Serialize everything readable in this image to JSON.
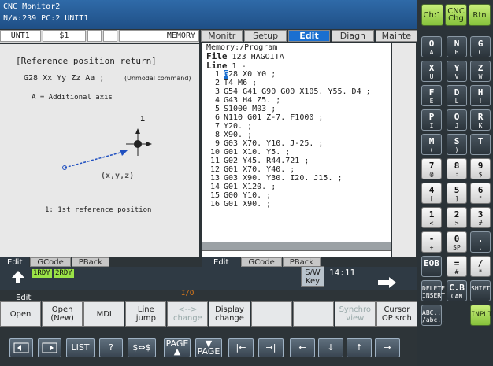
{
  "header": {
    "title_line1": "CNC Monitor2",
    "title_line2": "N/W:239 PC:2 UNIT1",
    "buttons": [
      "Ch:1",
      "CNC Chg",
      "Rtn"
    ]
  },
  "status_row": {
    "unit": "UNT1",
    "cell2": "$1",
    "mode": "MEMORY"
  },
  "guide": {
    "title": "[Reference position return]",
    "command": "G28 Xx Yy Zz Aa ;",
    "unmodal": "(Unmodal command)",
    "axis_note": "A = Additional axis",
    "point_label_1": "1",
    "point_label_xyz": "(x,y,z)",
    "ref_note": "1: 1st reference position"
  },
  "tabs": [
    "Monitr",
    "Setup",
    "Edit",
    "Diagn",
    "Mainte"
  ],
  "program": {
    "memory": "Memory:/Program",
    "file_label": "File",
    "file_name": "123_HAGOITA",
    "line_label": "Line",
    "line_value": "1 -",
    "lines": [
      {
        "n": "1",
        "t": "G28 X0 Y0 ;"
      },
      {
        "n": "2",
        "t": "T4 M6 ;"
      },
      {
        "n": "3",
        "t": "G54 G41 G90 G00 X105. Y55. D4 ;"
      },
      {
        "n": "4",
        "t": "G43 H4 Z5. ;"
      },
      {
        "n": "5",
        "t": "S1000 M03 ;"
      },
      {
        "n": "6",
        "t": "N110 G01 Z-7. F1000 ;"
      },
      {
        "n": "7",
        "t": "Y20. ;"
      },
      {
        "n": "8",
        "t": "X90. ;"
      },
      {
        "n": "9",
        "t": "G03 X70. Y10. J-25. ;"
      },
      {
        "n": "10",
        "t": "G01 X10. Y5. ;"
      },
      {
        "n": "11",
        "t": "G02 Y45. R44.721 ;"
      },
      {
        "n": "12",
        "t": "G01 X70. Y40. ;"
      },
      {
        "n": "13",
        "t": "G03 X90. Y30. I20. J15. ;"
      },
      {
        "n": "14",
        "t": "G01 X120. ;"
      },
      {
        "n": "15",
        "t": "G00 Y10. ;"
      },
      {
        "n": "16",
        "t": "G01 X90. ;"
      }
    ]
  },
  "left_modes": [
    "Edit",
    "GCode",
    "PBack"
  ],
  "right_modes": [
    "Edit",
    "GCode",
    "PBack"
  ],
  "status": {
    "rdy1": "1RDY",
    "rdy2": "2RDY",
    "sw_key": "S/W Key",
    "clock": "14:11",
    "mode_label": "Edit",
    "io": "I/O"
  },
  "softkeys": [
    {
      "l1": "Open",
      "l2": ""
    },
    {
      "l1": "Open",
      "l2": "(New)"
    },
    {
      "l1": "MDI",
      "l2": ""
    },
    {
      "l1": "Line",
      "l2": "jump"
    },
    {
      "l1": "<-->",
      "l2": "change"
    },
    {
      "l1": "Display",
      "l2": "change"
    },
    {
      "l1": "",
      "l2": ""
    },
    {
      "l1": "",
      "l2": ""
    },
    {
      "l1": "Synchro",
      "l2": "view"
    },
    {
      "l1": "Cursor",
      "l2": "OP srch"
    }
  ],
  "nav": {
    "list": "LIST",
    "help": "?",
    "swap": "$⇔$",
    "page_up": "PAGE",
    "page_down": "PAGE"
  },
  "keypad": {
    "rows": [
      [
        {
          "k": "O",
          "s": "A"
        },
        {
          "k": "N",
          "s": "B"
        },
        {
          "k": "G",
          "s": "C"
        }
      ],
      [
        {
          "k": "X",
          "s": "U"
        },
        {
          "k": "Y",
          "s": "V"
        },
        {
          "k": "Z",
          "s": "W"
        }
      ],
      [
        {
          "k": "F",
          "s": "E"
        },
        {
          "k": "D",
          "s": "L"
        },
        {
          "k": "H",
          "s": "!"
        }
      ],
      [
        {
          "k": "P",
          "s": "I"
        },
        {
          "k": "Q",
          "s": "J"
        },
        {
          "k": "R",
          "s": "K"
        }
      ],
      [
        {
          "k": "M",
          "s": "("
        },
        {
          "k": "S",
          "s": ")"
        },
        {
          "k": "T",
          "s": ""
        }
      ],
      [
        {
          "k": "7",
          "s": "@"
        },
        {
          "k": "8",
          "s": ":"
        },
        {
          "k": "9",
          "s": "$"
        }
      ],
      [
        {
          "k": "4",
          "s": "["
        },
        {
          "k": "5",
          "s": "]"
        },
        {
          "k": "6",
          "s": "\""
        }
      ],
      [
        {
          "k": "1",
          "s": "<"
        },
        {
          "k": "2",
          "s": ">"
        },
        {
          "k": "3",
          "s": "#"
        }
      ],
      [
        {
          "k": "-",
          "s": "+"
        },
        {
          "k": "0",
          "s": "SP"
        },
        {
          "k": ".",
          "s": ","
        }
      ],
      [
        {
          "k": "EOB",
          "s": ""
        },
        {
          "k": "=",
          "s": "#"
        },
        {
          "k": "/",
          "s": "*"
        }
      ],
      [
        {
          "k": "DELETE",
          "s": "INSERT"
        },
        {
          "k": "C.B",
          "s": "CAN"
        },
        {
          "k": "SHIFT",
          "s": ""
        }
      ],
      [
        {
          "k": "ABC..",
          "s": "/abc.."
        },
        {
          "k": "",
          "s": ""
        },
        {
          "k": "INPUT",
          "s": ""
        }
      ]
    ]
  }
}
